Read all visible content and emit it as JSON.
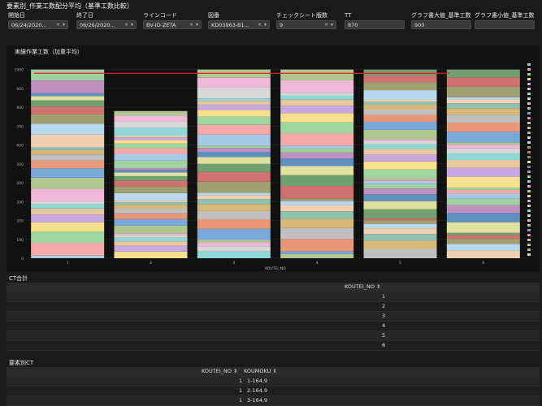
{
  "page": {
    "title": "要素別_作業工数配分平均（基準工数比較）"
  },
  "filters": [
    {
      "label": "開始日",
      "value": "06/24/2020...",
      "has_clear": true,
      "has_dropdown": true
    },
    {
      "label": "終了日",
      "value": "06/26/2020...",
      "has_clear": true,
      "has_dropdown": true
    },
    {
      "label": "ラインコード",
      "value": "BV-ID-ZETA",
      "has_clear": true,
      "has_dropdown": true
    },
    {
      "label": "図番",
      "value": "KD03963-B1...",
      "has_clear": true,
      "has_dropdown": true
    },
    {
      "label": "チェックシート版数",
      "value": "9",
      "has_clear": true,
      "has_dropdown": true
    },
    {
      "label": "TT",
      "value": "870",
      "has_clear": false,
      "has_dropdown": false
    },
    {
      "label": "グラフ書大値_基準工数",
      "value": "900",
      "has_clear": false,
      "has_dropdown": false
    },
    {
      "label": "グラフ書小値_基準工数",
      "value": "",
      "has_clear": false,
      "has_dropdown": false
    }
  ],
  "icons": {
    "clear": "×",
    "dropdown": "▾"
  },
  "chart_data": {
    "type": "bar",
    "stacked": true,
    "title": "実績作業工数（加重平均）",
    "categories": [
      "1",
      "2",
      "3",
      "4",
      "5",
      "6"
    ],
    "totals": [
      1000,
      780,
      1000,
      1000,
      1000,
      1000
    ],
    "xlabel": "KOUTEI_NO",
    "ylim": [
      0,
      1050
    ],
    "yticks": [
      0,
      100,
      200,
      300,
      400,
      500,
      600,
      700,
      800,
      900,
      1000
    ],
    "reference_line": {
      "value": 980,
      "color": "#e02020"
    },
    "palette": [
      "#a8c8e8",
      "#f4a9a8",
      "#9fd59f",
      "#f7e08c",
      "#c8a8e0",
      "#e8c8a0",
      "#8fd8d8",
      "#d8d8d8",
      "#f0b8d8",
      "#b0c890",
      "#7aa8d8",
      "#e89878",
      "#c0c0c0",
      "#d8b878",
      "#90c0b0",
      "#f0d0b0",
      "#b8d8f0",
      "#a0a070",
      "#d07070",
      "#70a070",
      "#e0e0a0",
      "#6090c0",
      "#c090c0",
      "#a0d0a0"
    ],
    "legend_position": "right"
  },
  "ct_table": {
    "title": "CT合計",
    "column": "KOUTEI_NO",
    "rows": [
      "1",
      "2",
      "3",
      "4",
      "5",
      "6"
    ]
  },
  "element_table": {
    "title": "要素別CT",
    "columns": [
      "KOUTEI_NO",
      "KOUMOKU"
    ],
    "rows": [
      {
        "koutei": "1",
        "koumoku": "1-164.9"
      },
      {
        "koutei": "1",
        "koumoku": "2-164.9"
      },
      {
        "koutei": "1",
        "koumoku": "3-164.9"
      }
    ]
  }
}
